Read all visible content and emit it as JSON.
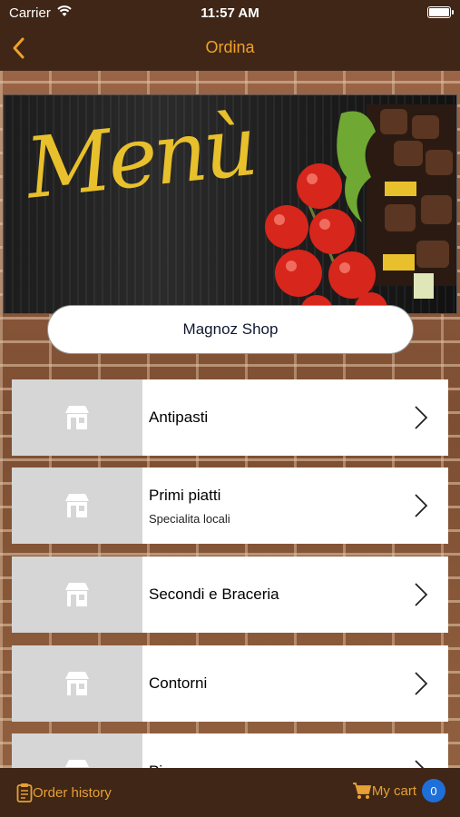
{
  "status": {
    "carrier": "Carrier",
    "time": "11:57 AM"
  },
  "nav": {
    "title": "Ordina",
    "back_icon": "chevron-left-icon"
  },
  "banner": {
    "script_text": "Menù"
  },
  "shop": {
    "name": "Magnoz Shop"
  },
  "categories": [
    {
      "label": "Antipasti",
      "sub": ""
    },
    {
      "label": "Primi piatti",
      "sub": "Specialita locali"
    },
    {
      "label": "Secondi e Braceria",
      "sub": ""
    },
    {
      "label": "Contorni",
      "sub": ""
    },
    {
      "label": "Pi",
      "sub": ""
    }
  ],
  "bottom": {
    "order_history": "Order history",
    "my_cart": "My cart",
    "cart_count": "0"
  },
  "colors": {
    "accent": "#f0a12a",
    "bar": "#3f2616",
    "badge": "#1e6fd9"
  }
}
